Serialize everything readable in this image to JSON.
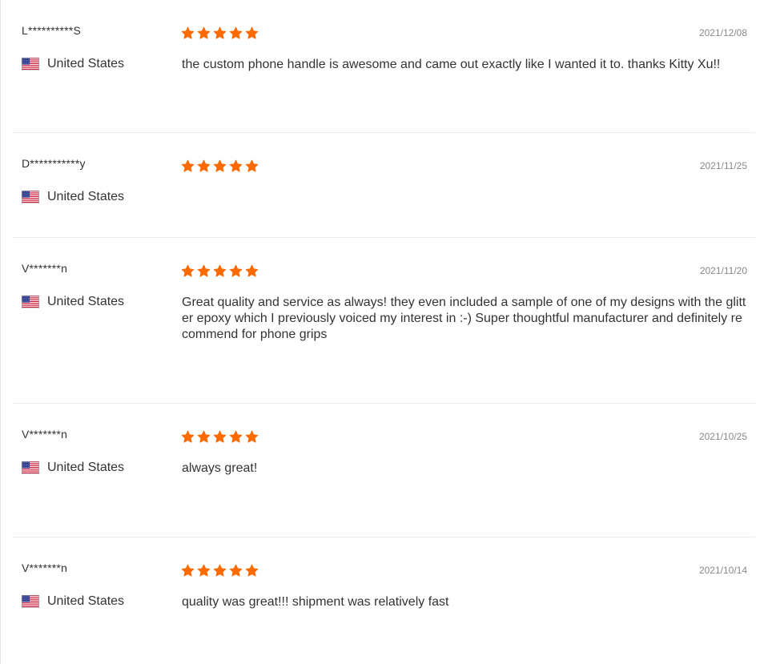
{
  "colors": {
    "star": "#ff6a00",
    "text": "#333333",
    "date": "#888888",
    "divider": "#ececec"
  },
  "icons": {
    "star": "star-icon",
    "flag": "us-flag-icon"
  },
  "reviews": [
    {
      "buyer": "L**********S",
      "country": "United States",
      "rating": 5,
      "date": "2021/12/08",
      "text": "the custom phone handle is awesome and came out exactly like I wanted it to. thanks Kitty Xu!!"
    },
    {
      "buyer": "D***********y",
      "country": "United States",
      "rating": 5,
      "date": "2021/11/25",
      "text": ""
    },
    {
      "buyer": "V*******n",
      "country": "United States",
      "rating": 5,
      "date": "2021/11/20",
      "text": "Great quality and service as always! they even included a sample of one of my designs with the glitter epoxy which I previously voiced my interest in :-) Super thoughtful manufacturer and definitely recommend for phone grips"
    },
    {
      "buyer": "V*******n",
      "country": "United States",
      "rating": 5,
      "date": "2021/10/25",
      "text": "always great!"
    },
    {
      "buyer": "V*******n",
      "country": "United States",
      "rating": 5,
      "date": "2021/10/14",
      "text": "quality was great!!! shipment was relatively fast"
    }
  ]
}
